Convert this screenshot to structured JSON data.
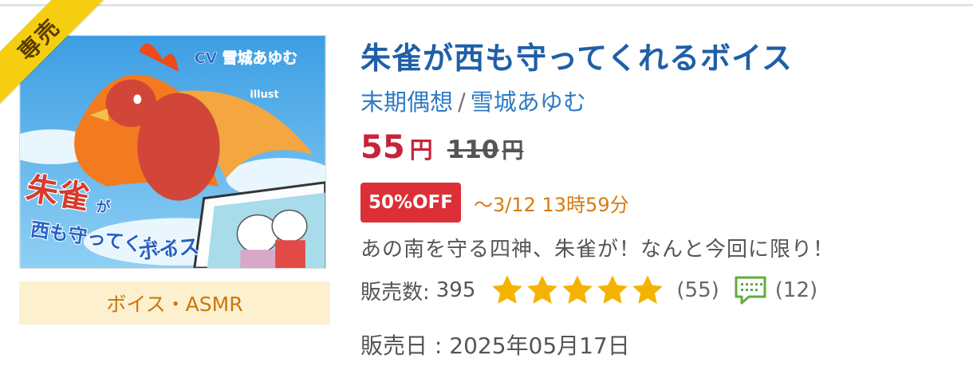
{
  "product": {
    "ribbon_label": "専売",
    "category": "ボイス・ASMR",
    "cover_texts": {
      "cv": "CV 雪城あゆむ",
      "illust": "illust",
      "title_lines": [
        "朱雀",
        "が",
        "西も守ってくれる",
        "ボイス"
      ]
    },
    "title": "朱雀が西も守ってくれるボイス",
    "circle": "末期偶想",
    "separator": "/",
    "voice_actor": "雪城あゆむ",
    "price": {
      "current": "55",
      "current_unit": "円",
      "original": "110",
      "original_unit": "円"
    },
    "discount_label": "50%OFF",
    "deadline": "〜3/12 13時59分",
    "catchphrase": "あの南を守る四神、朱雀が！なんと今回に限り！",
    "sales_label": "販売数:",
    "sales_count": "395",
    "rating_stars": 5,
    "rating_count": "(55)",
    "review_count": "(12)",
    "release_label": "販売日 : ",
    "release_date": "2025年05月17日",
    "colors": {
      "title": "#1f5fa8",
      "price": "#c7243a",
      "discount_badge": "#dc2f37",
      "deadline": "#d57a10",
      "ribbon": "#f5cf0f",
      "star": "#f5b301",
      "category_bg": "#fcf0cf"
    },
    "icons": [
      "star-icon",
      "comment-icon"
    ]
  }
}
